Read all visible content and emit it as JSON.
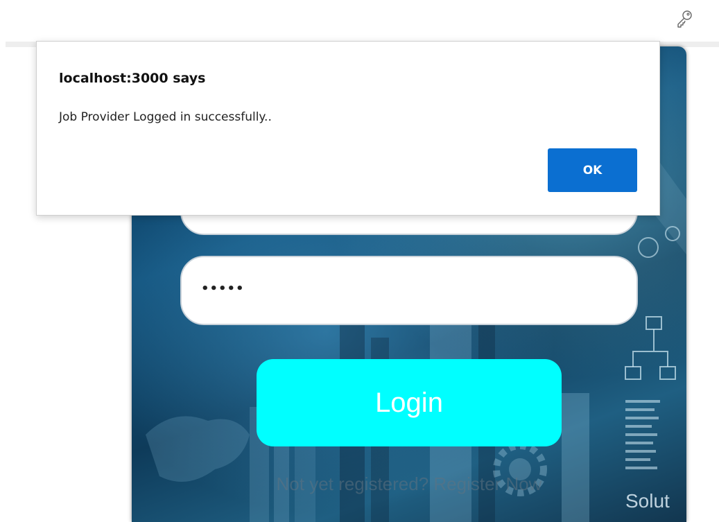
{
  "browser": {
    "key_icon": "key-icon"
  },
  "login_form": {
    "password_value": "•••••",
    "login_label": "Login",
    "register_text": "Not yet registered? Register Now",
    "background_text": "Solut"
  },
  "alert_dialog": {
    "title": "localhost:3000 says",
    "message": "Job Provider Logged in successfully..",
    "ok_label": "OK"
  },
  "colors": {
    "login_button": "#00ffff",
    "ok_button": "#0b6fd1",
    "card_background": "#14547e"
  }
}
